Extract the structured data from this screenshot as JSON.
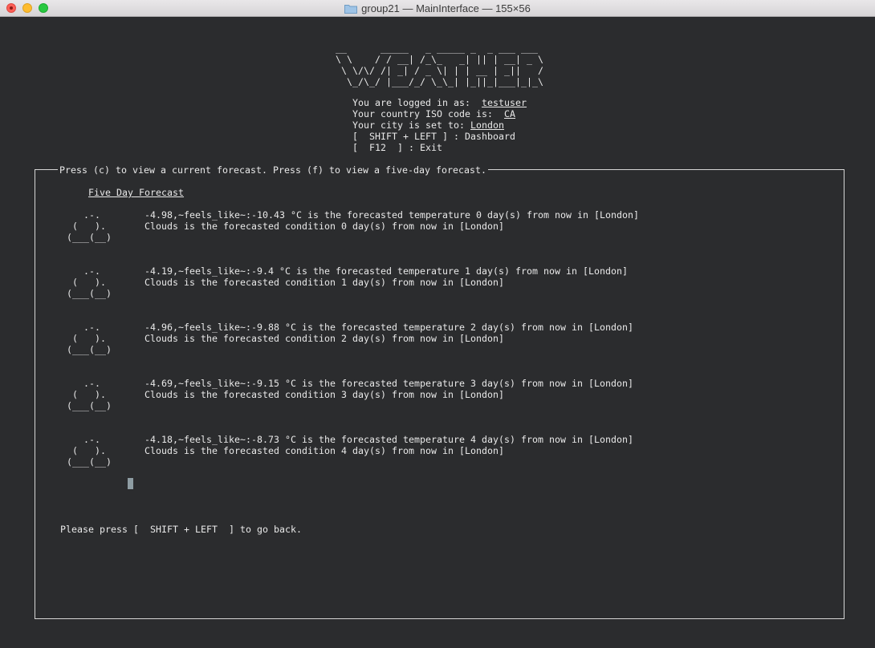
{
  "window": {
    "title": "group21 — MainInterface — 155×56"
  },
  "banner": {
    "lines": [
      "__      _____   _ _____ _  _ ___ ___",
      "\\ \\    / / __| /_\\_   _| || | __| _ \\",
      " \\ \\/\\/ /| _| / _ \\| | | __ | _||   /",
      "  \\_/\\_/ |___/_/ \\_\\_| |_||_|___|_|_\\"
    ]
  },
  "info": {
    "logged_in_label": "You are logged in as:  ",
    "username": "testuser",
    "country_label": "Your country ISO code is:  ",
    "country": "CA",
    "city_label": "Your city is set to: ",
    "city": "London",
    "shortcut_dashboard": "[  SHIFT + LEFT ] : Dashboard",
    "shortcut_exit": "[  F12  ] : Exit"
  },
  "panel": {
    "title": "Press (c) to view a current forecast. Press (f) to view a five-day forecast.",
    "heading": "Five Day Forecast",
    "cloud_icon": {
      "name": "cloud-icon",
      "lines": [
        "   .-.",
        " (   ).",
        "(___(__)"
      ]
    },
    "forecasts": [
      {
        "temperature": "-4.98,~feels_like~:-10.43 °C is the forecasted temperature 0 day(s) from now in [London]",
        "condition": "Clouds is the forecasted condition 0 day(s) from now in [London]"
      },
      {
        "temperature": "-4.19,~feels_like~:-9.4 °C is the forecasted temperature 1 day(s) from now in [London]",
        "condition": "Clouds is the forecasted condition 1 day(s) from now in [London]"
      },
      {
        "temperature": "-4.96,~feels_like~:-9.88 °C is the forecasted temperature 2 day(s) from now in [London]",
        "condition": "Clouds is the forecasted condition 2 day(s) from now in [London]"
      },
      {
        "temperature": "-4.69,~feels_like~:-9.15 °C is the forecasted temperature 3 day(s) from now in [London]",
        "condition": "Clouds is the forecasted condition 3 day(s) from now in [London]"
      },
      {
        "temperature": "-4.18,~feels_like~:-8.73 °C is the forecasted temperature 4 day(s) from now in [London]",
        "condition": "Clouds is the forecasted condition 4 day(s) from now in [London]"
      }
    ],
    "back_hint": "Please press [  SHIFT + LEFT  ] to go back."
  }
}
